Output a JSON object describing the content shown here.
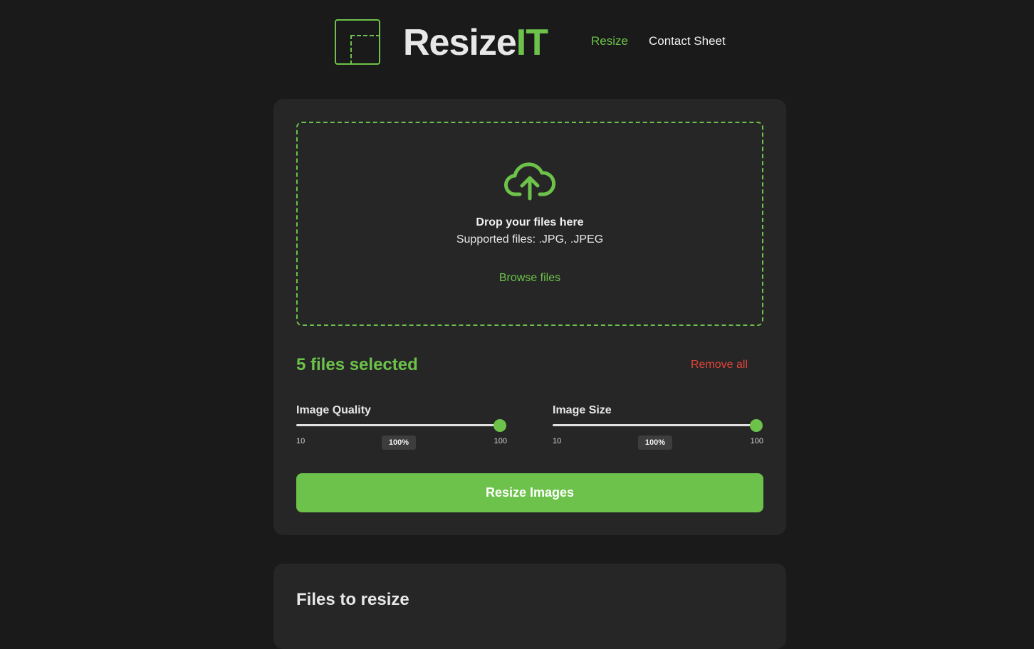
{
  "brand": {
    "name_main": "Resize",
    "name_accent": "IT"
  },
  "nav": {
    "resize": "Resize",
    "contact_sheet": "Contact Sheet"
  },
  "dropzone": {
    "icon": "cloud-upload-icon",
    "title": "Drop your files here",
    "subtitle": "Supported files: .JPG, .JPEG",
    "browse": "Browse files"
  },
  "selection": {
    "count_label": "5 files selected",
    "remove_all": "Remove all"
  },
  "sliders": {
    "quality": {
      "label": "Image Quality",
      "min": "10",
      "max": "100",
      "value": "100%"
    },
    "size": {
      "label": "Image Size",
      "min": "10",
      "max": "100",
      "value": "100%"
    }
  },
  "actions": {
    "resize": "Resize Images"
  },
  "files_section": {
    "title": "Files to resize"
  },
  "colors": {
    "background": "#1a1a1a",
    "card": "#262626",
    "accent": "#6cc24a",
    "danger": "#e0453a"
  }
}
